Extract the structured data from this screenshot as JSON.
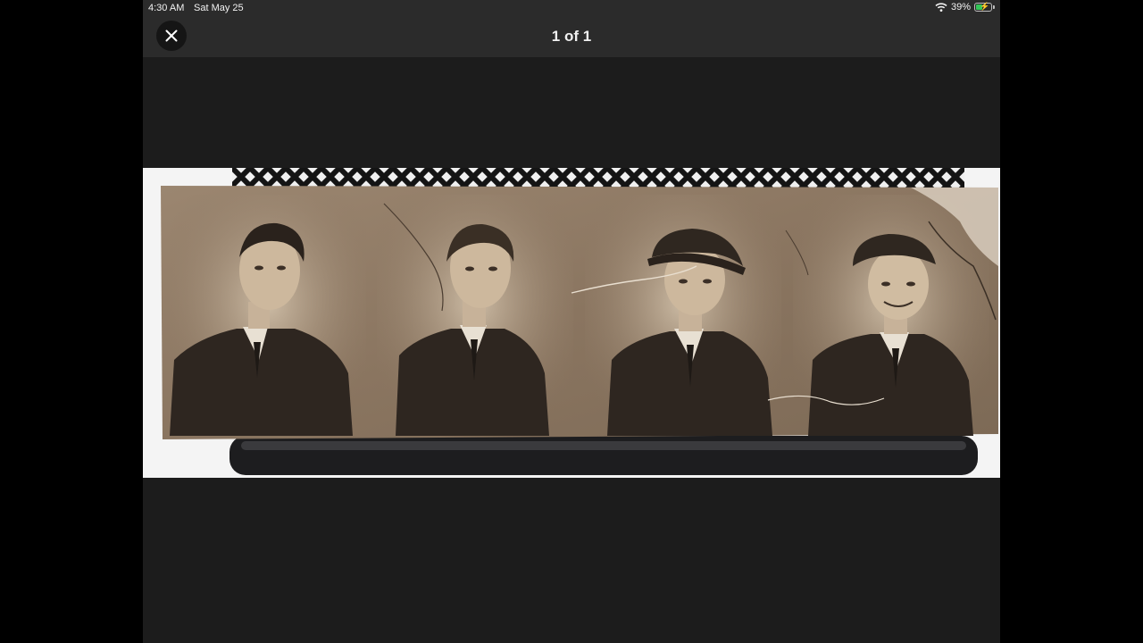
{
  "status_bar": {
    "time": "4:30 AM",
    "date": "Sat May 25",
    "battery": "39%",
    "battery_level": 0.39
  },
  "viewer": {
    "page_counter": "1 of 1"
  },
  "icons": {
    "close": "close-icon",
    "wifi": "wifi-icon",
    "battery": "battery-icon"
  },
  "colors": {
    "background": "#1c1c1c",
    "bar": "#2b2b2b",
    "photo_sepia": "#8a7560"
  }
}
